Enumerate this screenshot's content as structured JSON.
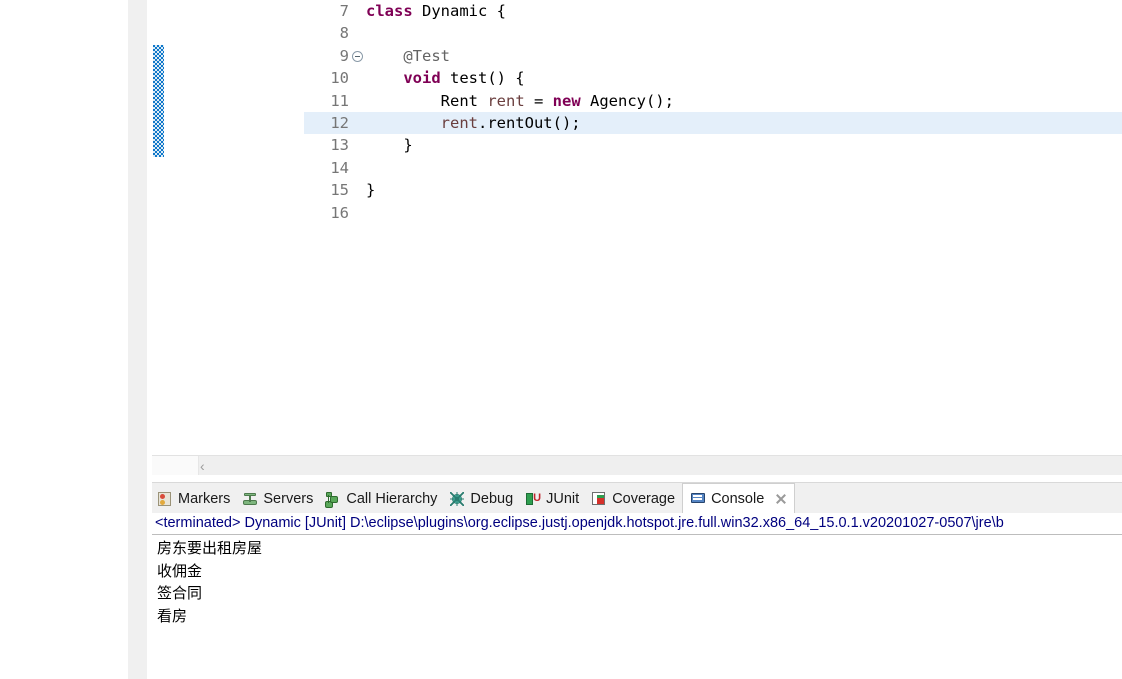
{
  "editor": {
    "language": "java",
    "highlighted_line": 12,
    "lines": [
      {
        "no": "7",
        "folding": false,
        "segments": [
          {
            "t": "class ",
            "c": "kw"
          },
          {
            "t": "Dynamic {",
            "c": "plain"
          }
        ]
      },
      {
        "no": "8",
        "folding": false,
        "segments": [
          {
            "t": "",
            "c": "plain"
          }
        ]
      },
      {
        "no": "9",
        "folding": true,
        "segments": [
          {
            "t": "    @Test",
            "c": "anno"
          }
        ]
      },
      {
        "no": "10",
        "folding": false,
        "segments": [
          {
            "t": "    ",
            "c": "plain"
          },
          {
            "t": "void",
            "c": "kw"
          },
          {
            "t": " test() {",
            "c": "plain"
          }
        ]
      },
      {
        "no": "11",
        "folding": false,
        "segments": [
          {
            "t": "        Rent ",
            "c": "plain"
          },
          {
            "t": "rent",
            "c": "field"
          },
          {
            "t": " = ",
            "c": "plain"
          },
          {
            "t": "new",
            "c": "kw"
          },
          {
            "t": " Agency();",
            "c": "plain"
          }
        ]
      },
      {
        "no": "12",
        "folding": false,
        "segments": [
          {
            "t": "        ",
            "c": "plain"
          },
          {
            "t": "rent",
            "c": "field"
          },
          {
            "t": ".rentOut();",
            "c": "plain"
          }
        ]
      },
      {
        "no": "13",
        "folding": false,
        "segments": [
          {
            "t": "    }",
            "c": "plain"
          }
        ]
      },
      {
        "no": "14",
        "folding": false,
        "segments": [
          {
            "t": "",
            "c": "plain"
          }
        ]
      },
      {
        "no": "15",
        "folding": false,
        "segments": [
          {
            "t": "}",
            "c": "plain"
          }
        ]
      },
      {
        "no": "16",
        "folding": false,
        "segments": [
          {
            "t": "",
            "c": "plain"
          }
        ]
      }
    ],
    "scroll_left_arrow": "‹"
  },
  "bottom_panel": {
    "tabs": [
      {
        "label": "Markers",
        "icon": "markers-icon",
        "icon_class": "ico-markers",
        "active": false,
        "closable": false
      },
      {
        "label": "Servers",
        "icon": "servers-icon",
        "icon_class": "ico-servers",
        "active": false,
        "closable": false
      },
      {
        "label": "Call Hierarchy",
        "icon": "call-hierarchy-icon",
        "icon_class": "ico-callhier",
        "active": false,
        "closable": false
      },
      {
        "label": "Debug",
        "icon": "debug-icon",
        "icon_class": "ico-debug",
        "active": false,
        "closable": false
      },
      {
        "label": "JUnit",
        "icon": "junit-icon",
        "icon_class": "ico-junit",
        "active": false,
        "closable": false
      },
      {
        "label": "Coverage",
        "icon": "coverage-icon",
        "icon_class": "ico-coverage",
        "active": false,
        "closable": false
      },
      {
        "label": "Console",
        "icon": "console-icon",
        "icon_class": "ico-console",
        "active": true,
        "closable": true
      }
    ],
    "console": {
      "process_header": "<terminated> Dynamic [JUnit] D:\\eclipse\\plugins\\org.eclipse.justj.openjdk.hotspot.jre.full.win32.x86_64_15.0.1.v20201027-0507\\jre\\b",
      "output": [
        "房东要出租房屋",
        "收佣金",
        "签合同",
        "看房"
      ]
    }
  },
  "colors": {
    "keyword": "#7f0055",
    "annotation": "#646464",
    "field": "#6a3e3e",
    "highlight_line": "#e4effa",
    "change_bar": "#0e77c9",
    "console_header_text": "#00007f",
    "tab_bar_bg": "#f0f0f0"
  }
}
